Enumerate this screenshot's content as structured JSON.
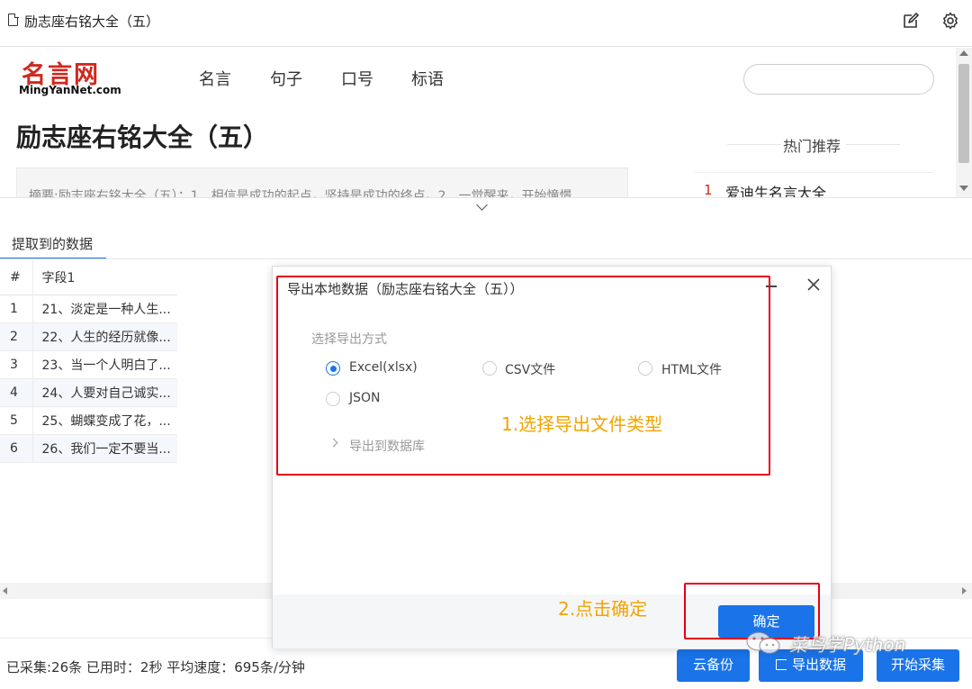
{
  "window": {
    "title": "励志座右铭大全（五）"
  },
  "site": {
    "logo_main": "名言网",
    "logo_sub": "MingYanNet.com",
    "nav": [
      "名言",
      "句子",
      "口号",
      "标语"
    ],
    "article_title": "励志座右铭大全（五）",
    "summary": "摘要:励志座右铭大全（五）：1、相信是成功的起点，坚持是成功的终点。2、一觉醒来，开始憧憬",
    "hot_title": "热门推荐",
    "hot_items": [
      {
        "num": "1",
        "text": "爱迪生名言大全"
      }
    ]
  },
  "data_panel": {
    "tab_label": "提取到的数据",
    "columns": [
      "#",
      "字段1"
    ],
    "rows": [
      {
        "num": "1",
        "field1": "21、淡定是一种人生..."
      },
      {
        "num": "2",
        "field1": "22、人生的经历就像..."
      },
      {
        "num": "3",
        "field1": "23、当一个人明白了..."
      },
      {
        "num": "4",
        "field1": "24、人要对自己诚实..."
      },
      {
        "num": "5",
        "field1": "25、蝴蝶变成了花，..."
      },
      {
        "num": "6",
        "field1": "26、我们一定不要当..."
      }
    ]
  },
  "status": {
    "text": "已采集:26条 已用时：2秒 平均速度：695条/分钟"
  },
  "buttons": {
    "cloud_backup": "云备份",
    "export_data": "导出数据",
    "start_collect": "开始采集"
  },
  "modal": {
    "title": "导出本地数据（励志座右铭大全（五））",
    "section_label": "选择导出方式",
    "options": [
      {
        "label": "Excel(xlsx)",
        "checked": true
      },
      {
        "label": "CSV文件",
        "checked": false
      },
      {
        "label": "HTML文件",
        "checked": false
      },
      {
        "label": "JSON",
        "checked": false
      }
    ],
    "export_db": "导出到数据库",
    "confirm": "确定"
  },
  "annotations": {
    "step1": "1.选择导出文件类型",
    "step2": "2.点击确定",
    "color": "#e60012",
    "text_color": "#f2a500"
  },
  "watermark": {
    "text": "菜鸟学Python"
  },
  "colors": {
    "accent": "#1a73e8",
    "logo_red": "#d0281f"
  }
}
